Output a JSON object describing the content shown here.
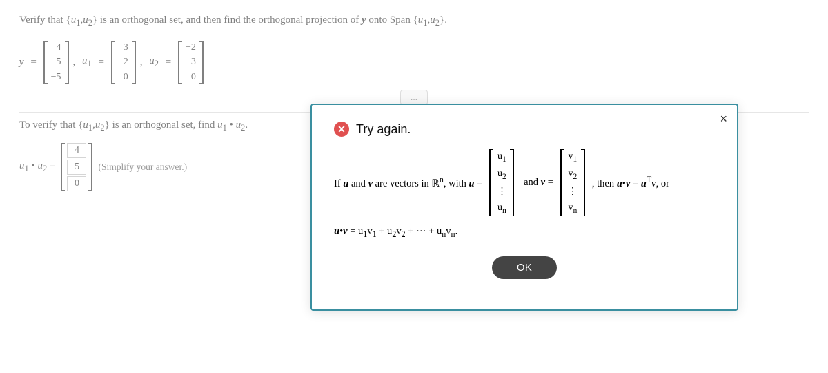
{
  "page": {
    "problem": {
      "intro": "Verify that ",
      "set_label": "{u₁,u₂}",
      "middle": " is an orthogonal set, and then find the orthogonal projection of ",
      "bold_y": "y",
      "end": " onto Span",
      "span_label": "{u₁,u₂}.",
      "y_vector": [
        "4",
        "5",
        "− 5"
      ],
      "u1_vector": [
        "3",
        "2",
        "0"
      ],
      "u2_vector": [
        "− 2",
        "3",
        "0"
      ]
    },
    "verify": {
      "text": "To verify that ",
      "set_label": "{u₁,u₂}",
      "text2": " is an orthogonal set, find ",
      "find_label": "u₁ • u₂.",
      "dot_product_label": "u₁ • u₂ =",
      "input_values": [
        "4",
        "5",
        "0"
      ],
      "simplify_note": "(Simplify your answer.)"
    },
    "ellipsis": "...",
    "modal": {
      "title": "Try again.",
      "body_before": "If ",
      "u_bold": "u",
      "body_and": " and ",
      "v_bold": "v",
      "body_after": " are vectors in ℝⁿ, with ",
      "u_eq": "u =",
      "and_v": "and v =",
      "then_text": ", then u•v = u",
      "T_super": "T",
      "v_text": "v, or",
      "u_matrix": [
        "u₁",
        "u₂",
        "⋯",
        "uₙ"
      ],
      "v_matrix": [
        "v₁",
        "v₂",
        "⋯",
        "vₙ"
      ],
      "formula": "u•v = u₁v₁ + u₂v₂ + ⋯ + uₙvₙ.",
      "ok_label": "OK",
      "close_label": "×"
    }
  }
}
